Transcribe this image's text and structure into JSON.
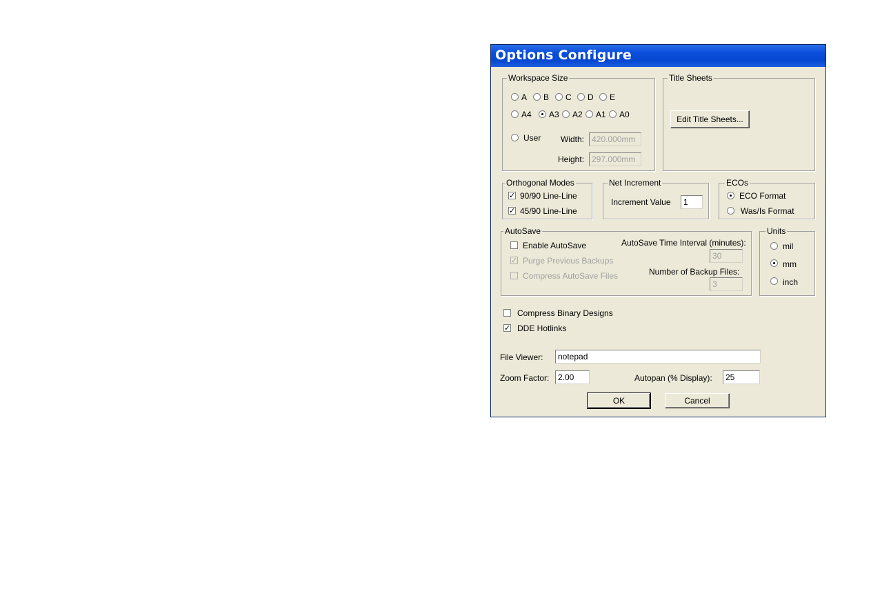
{
  "window": {
    "title": "Options Configure"
  },
  "workspace": {
    "label": "Workspace Size",
    "row1": [
      "A",
      "B",
      "C",
      "D",
      "E"
    ],
    "row2": [
      "A4",
      "A3",
      "A2",
      "A1",
      "A0"
    ],
    "selected": "A3",
    "user_label": "User",
    "width_label": "Width:",
    "width_value": "420.000mm",
    "height_label": "Height:",
    "height_value": "297.000mm"
  },
  "title_sheets": {
    "label": "Title Sheets",
    "button": "Edit Title Sheets..."
  },
  "orthogonal": {
    "label": "Orthogonal Modes",
    "items": [
      {
        "label": "90/90  Line-Line",
        "checked": true
      },
      {
        "label": "45/90  Line-Line",
        "checked": true
      }
    ]
  },
  "net_increment": {
    "label": "Net Increment",
    "field_label": "Increment Value",
    "value": "1"
  },
  "ecos": {
    "label": "ECOs",
    "options": [
      "ECO Format",
      "Was/Is Format"
    ],
    "selected": "ECO Format"
  },
  "autosave": {
    "label": "AutoSave",
    "enable": {
      "label": "Enable AutoSave",
      "checked": false
    },
    "purge": {
      "label": "Purge Previous Backups",
      "checked": true,
      "disabled": true
    },
    "compress": {
      "label": "Compress AutoSave Files",
      "checked": false,
      "disabled": true
    },
    "interval_label": "AutoSave Time Interval (minutes):",
    "interval_value": "30",
    "backups_label": "Number of Backup Files:",
    "backups_value": "3"
  },
  "units": {
    "label": "Units",
    "options": [
      "mil",
      "mm",
      "inch"
    ],
    "selected": "mm"
  },
  "options": {
    "compress_binary": {
      "label": "Compress Binary Designs",
      "checked": false
    },
    "dde_hotlinks": {
      "label": "DDE Hotlinks",
      "checked": true
    }
  },
  "file_viewer": {
    "label": "File Viewer:",
    "value": "notepad"
  },
  "zoom": {
    "label": "Zoom Factor:",
    "value": "2.00"
  },
  "autopan": {
    "label": "Autopan (% Display):",
    "value": "25"
  },
  "buttons": {
    "ok": "OK",
    "cancel": "Cancel"
  },
  "colors": {
    "title_bar": "#0a4fdc",
    "dialog_bg": "#ece9d8"
  }
}
